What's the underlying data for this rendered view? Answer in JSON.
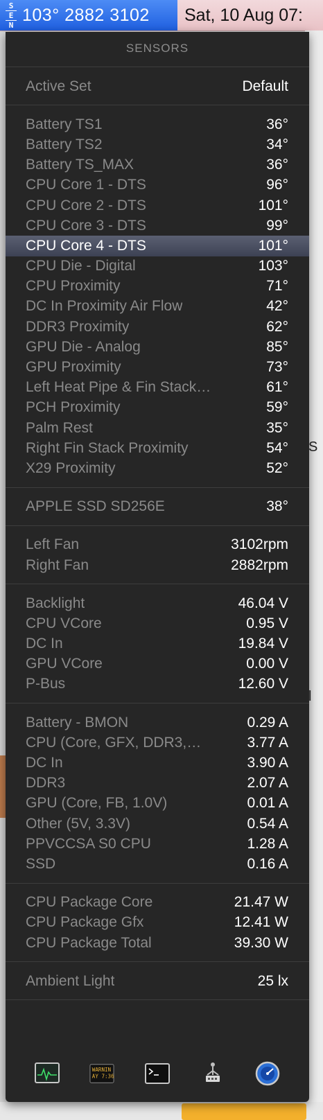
{
  "menubar": {
    "logo_letters": [
      "S",
      "E",
      "N"
    ],
    "readout": "103° 2882 3102",
    "clock": "Sat, 10 Aug  07:"
  },
  "panel": {
    "title": "SENSORS",
    "active_set": {
      "label": "Active Set",
      "value": "Default"
    },
    "temperatures": [
      {
        "label": "Battery TS1",
        "value": "36°"
      },
      {
        "label": "Battery TS2",
        "value": "34°"
      },
      {
        "label": "Battery TS_MAX",
        "value": "36°"
      },
      {
        "label": "CPU Core 1 - DTS",
        "value": "96°"
      },
      {
        "label": "CPU Core 2 - DTS",
        "value": "101°"
      },
      {
        "label": "CPU Core 3 - DTS",
        "value": "99°"
      },
      {
        "label": "CPU Core 4 - DTS",
        "value": "101°",
        "selected": true
      },
      {
        "label": "CPU Die - Digital",
        "value": "103°"
      },
      {
        "label": "CPU Proximity",
        "value": "71°"
      },
      {
        "label": "DC In Proximity Air Flow",
        "value": "42°"
      },
      {
        "label": "DDR3 Proximity",
        "value": "62°"
      },
      {
        "label": "GPU Die - Analog",
        "value": "85°"
      },
      {
        "label": "GPU Proximity",
        "value": "73°"
      },
      {
        "label": "Left Heat Pipe & Fin Stack…",
        "value": "61°"
      },
      {
        "label": "PCH Proximity",
        "value": "59°"
      },
      {
        "label": "Palm Rest",
        "value": "35°"
      },
      {
        "label": "Right Fin Stack Proximity",
        "value": "54°"
      },
      {
        "label": "X29 Proximity",
        "value": "52°"
      }
    ],
    "disks": [
      {
        "label": "APPLE SSD SD256E",
        "value": "38°"
      }
    ],
    "fans": [
      {
        "label": "Left Fan",
        "value": "3102rpm"
      },
      {
        "label": "Right Fan",
        "value": "2882rpm"
      }
    ],
    "voltages": [
      {
        "label": "Backlight",
        "value": "46.04 V"
      },
      {
        "label": "CPU VCore",
        "value": "0.95 V"
      },
      {
        "label": "DC In",
        "value": "19.84 V"
      },
      {
        "label": "GPU VCore",
        "value": "0.00 V"
      },
      {
        "label": "P-Bus",
        "value": "12.60 V"
      }
    ],
    "currents": [
      {
        "label": "Battery - BMON",
        "value": "0.29 A"
      },
      {
        "label": "CPU (Core, GFX, DDR3,…",
        "value": "3.77 A"
      },
      {
        "label": "DC In",
        "value": "3.90 A"
      },
      {
        "label": "DDR3",
        "value": "2.07 A"
      },
      {
        "label": "GPU (Core, FB, 1.0V)",
        "value": "0.01 A"
      },
      {
        "label": "Other (5V, 3.3V)",
        "value": "0.54 A"
      },
      {
        "label": "PPVCCSA S0 CPU",
        "value": "1.28 A"
      },
      {
        "label": "SSD",
        "value": "0.16 A"
      }
    ],
    "power": [
      {
        "label": "CPU Package Core",
        "value": "21.47 W"
      },
      {
        "label": "CPU Package Gfx",
        "value": "12.41 W"
      },
      {
        "label": "CPU Package Total",
        "value": "39.30 W"
      }
    ],
    "light": [
      {
        "label": "Ambient Light",
        "value": "25 lx"
      }
    ],
    "toolbar": {
      "icons": [
        "activity-monitor-icon",
        "console-icon",
        "terminal-icon",
        "usb-tree-icon",
        "network-utility-icon"
      ],
      "console_text_1": "WARNIN",
      "console_text_2": "AY 7:36"
    }
  },
  "colors": {
    "panel_bg": "#262626",
    "label": "#8a8a8a",
    "value": "#ffffff",
    "highlight": "#4a4f60",
    "menubar_active": "#3a78ee"
  }
}
